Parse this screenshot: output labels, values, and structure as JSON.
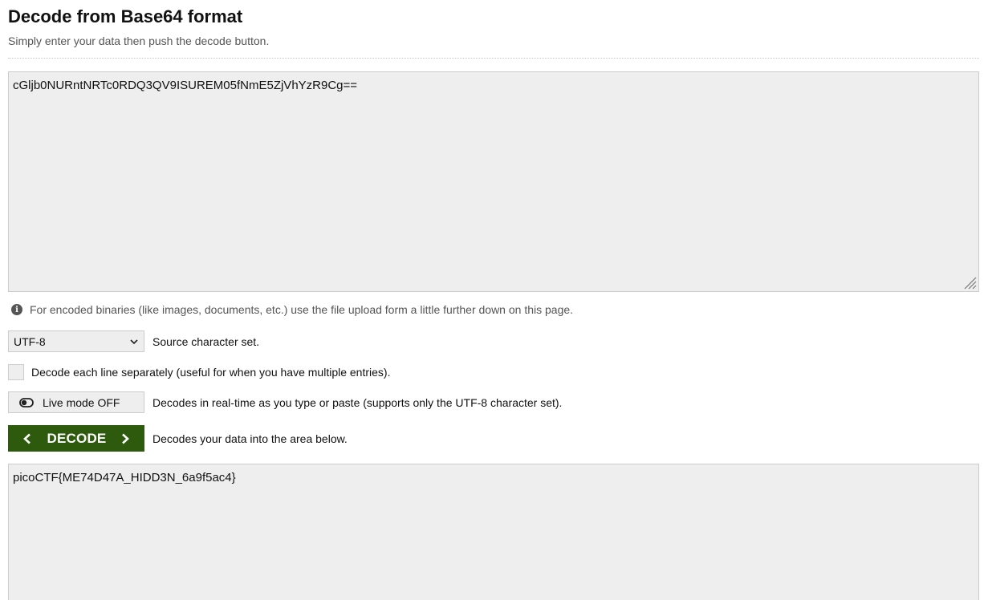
{
  "header": {
    "title": "Decode from Base64 format",
    "subtitle": "Simply enter your data then push the decode button."
  },
  "input": {
    "value": "cGljb0NURntNRTc0RDQ3QV9ISUREM05fNmE5ZjVhYzR9Cg=="
  },
  "info": {
    "icon": "info-icon",
    "text": "For encoded binaries (like images, documents, etc.) use the file upload form a little further down on this page."
  },
  "charset": {
    "selected": "UTF-8",
    "label": "Source character set."
  },
  "lines": {
    "checked": false,
    "label": "Decode each line separately (useful for when you have multiple entries)."
  },
  "live_mode": {
    "button_label": "Live mode OFF",
    "description": "Decodes in real-time as you type or paste (supports only the UTF-8 character set)."
  },
  "decode": {
    "button_label": "DECODE",
    "description": "Decodes your data into the area below.",
    "color": "#2d5a0c"
  },
  "output": {
    "value": "picoCTF{ME74D47A_HIDD3N_6a9f5ac4}"
  }
}
